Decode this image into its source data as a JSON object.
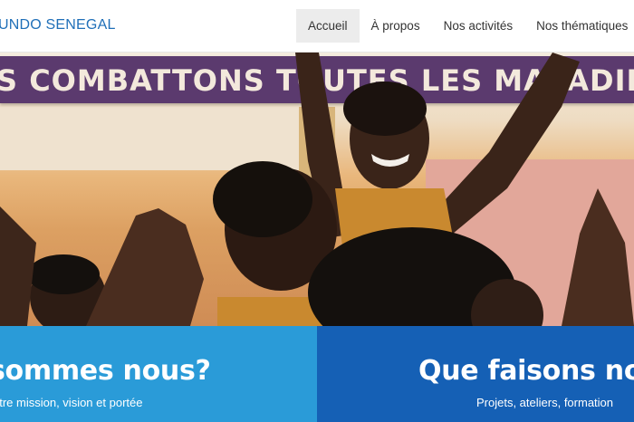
{
  "header": {
    "brand": "UNDO SENEGAL",
    "nav": [
      {
        "label": "Accueil",
        "active": true
      },
      {
        "label": "À propos",
        "active": false
      },
      {
        "label": "Nos activités",
        "active": false
      },
      {
        "label": "Nos thématiques",
        "active": false
      }
    ]
  },
  "hero": {
    "banner_text": "S COMBATTONS TOUTES LES MALADIES"
  },
  "cards": [
    {
      "title": "sommes nous?",
      "subtitle": "otre mission, vision et portée"
    },
    {
      "title": "Que faisons no",
      "subtitle": "Projets, ateliers, formation"
    }
  ],
  "colors": {
    "brand": "#1f6fb8",
    "card_left": "#2a9bd8",
    "card_right": "#1560b5",
    "banner": "#5b3a6e"
  }
}
